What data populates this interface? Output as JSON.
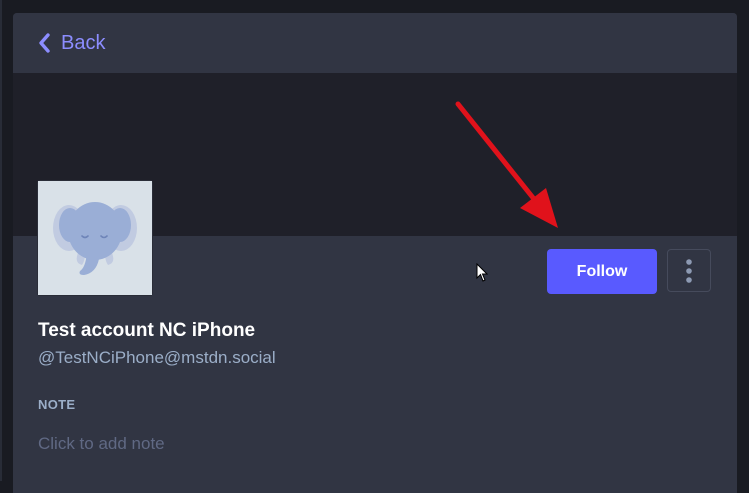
{
  "header": {
    "back_label": "Back",
    "back_icon": "chevron-left-icon"
  },
  "profile": {
    "avatar_icon": "elephant-avatar",
    "display_name": "Test account NC iPhone",
    "acct": "@TestNCiPhone@mstdn.social"
  },
  "actions": {
    "follow_label": "Follow",
    "menu_icon": "more-vertical-icon"
  },
  "note": {
    "label": "NOTE",
    "placeholder": "Click to add note",
    "value": ""
  },
  "colors": {
    "accent": "#8c8dff",
    "button": "#595aff",
    "panel": "#313543",
    "banner": "#1f2029",
    "annotation_arrow": "#e0121b"
  }
}
